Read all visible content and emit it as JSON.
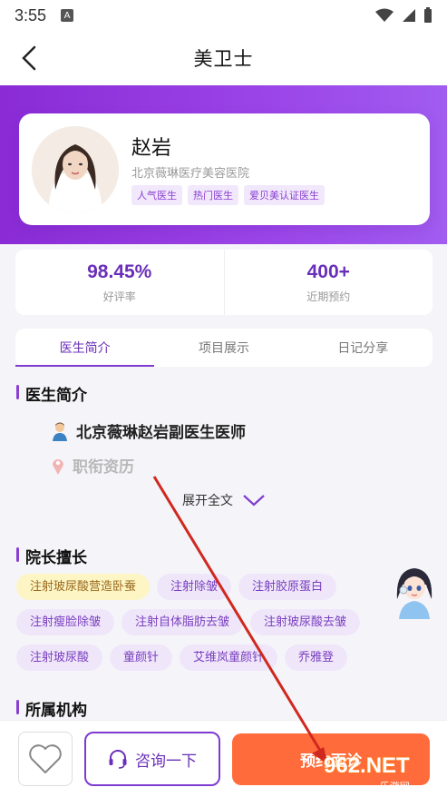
{
  "status_bar": {
    "time": "3:55",
    "a_label": "A"
  },
  "nav": {
    "title": "美卫士"
  },
  "doctor": {
    "name": "赵岩",
    "hospital": "北京薇琳医疗美容医院",
    "tags": [
      "人气医生",
      "热门医生",
      "爱贝美认证医生"
    ]
  },
  "stats": [
    {
      "value": "98.45%",
      "label": "好评率"
    },
    {
      "value": "400+",
      "label": "近期预约"
    }
  ],
  "tabs": [
    "医生简介",
    "项目展示",
    "日记分享"
  ],
  "intro": {
    "title": "医生简介",
    "line1": "北京薇琳赵岩副医生医师",
    "line2": "职衔资历",
    "expand_label": "展开全文"
  },
  "skills_section": {
    "title": "院长擅长",
    "items": [
      "注射玻尿酸营造卧蚕",
      "注射除皱",
      "注射胶原蛋白",
      "注射瘦脸除皱",
      "注射自体脂肪去皱",
      "注射玻尿酸去皱",
      "注射玻尿酸",
      "童颜针",
      "艾维岚童颜针",
      "乔雅登"
    ]
  },
  "org_section": {
    "title": "所属机构"
  },
  "bottom": {
    "consult_label": "咨询一下",
    "book_label": "预约面诊"
  },
  "watermark": {
    "line1": "962.NET",
    "line2": "乐游网"
  },
  "colors": {
    "primary": "#8a2bd6",
    "accent": "#ff6b3a",
    "annotation_arrow": "#d0281f"
  }
}
